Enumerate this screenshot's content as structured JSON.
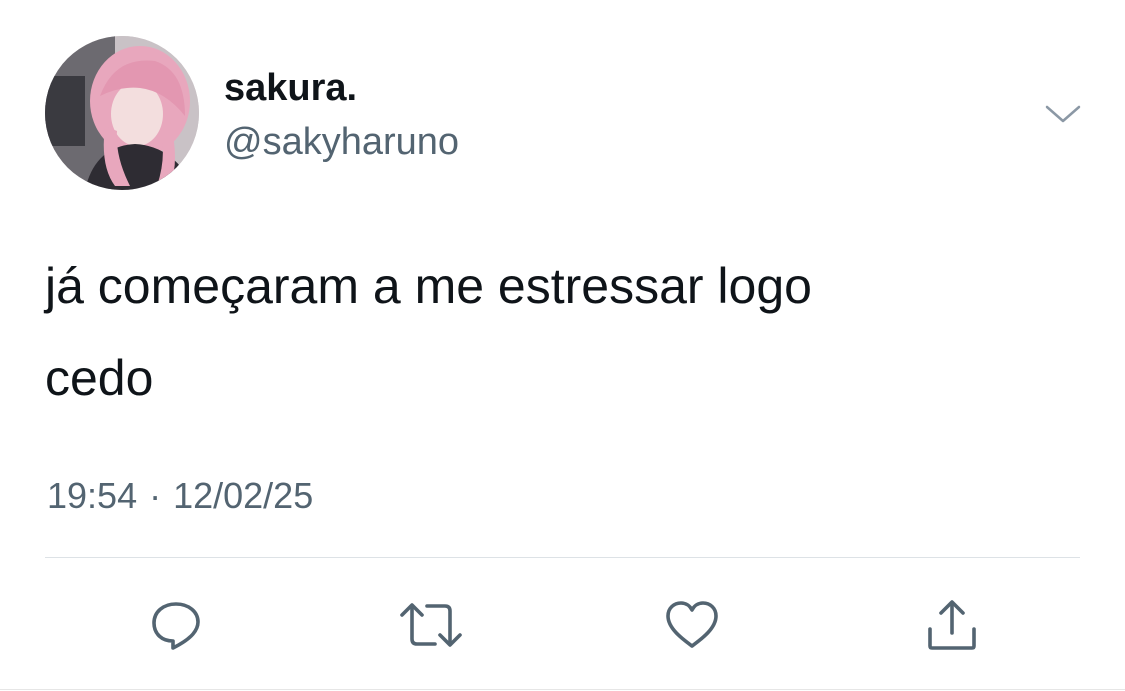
{
  "tweet": {
    "display_name": "sakura.",
    "handle": "@sakyharuno",
    "text_line_1": "já começaram a me estressar logo",
    "text_line_2": "cedo",
    "time": "19:54",
    "separator": "·",
    "date": "12/02/25"
  },
  "actions": {
    "reply_icon": "reply-icon",
    "retweet_icon": "retweet-icon",
    "like_icon": "heart-icon",
    "share_icon": "share-icon"
  },
  "colors": {
    "primary_text": "#0f1419",
    "secondary_text": "#536471",
    "icon_gray": "#536471",
    "divider": "#dde2e6"
  }
}
